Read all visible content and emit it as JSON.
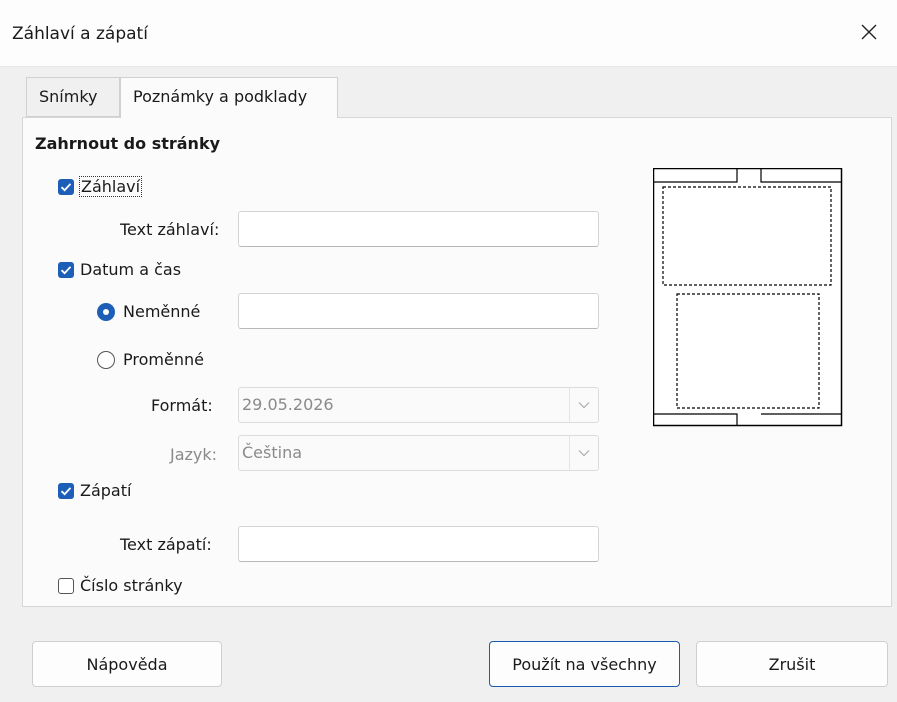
{
  "window": {
    "title": "Záhlaví a zápatí"
  },
  "tabs": [
    {
      "label": "Snímky"
    },
    {
      "label": "Poznámky a podklady"
    }
  ],
  "section": {
    "title": "Zahrnout do stránky"
  },
  "header": {
    "label": "Záhlaví",
    "checked": true,
    "text_label": "Text záhlaví:",
    "text_value": ""
  },
  "datetime": {
    "label": "Datum a čas",
    "checked": true,
    "fixed_label": "Neměnné",
    "fixed_value": "",
    "variable_label": "Proměnné",
    "format_label": "Formát:",
    "format_value": "29.05.2026",
    "language_label": "Jazyk:",
    "language_value": "Čeština"
  },
  "footer": {
    "label": "Zápatí",
    "checked": true,
    "text_label": "Text zápatí:",
    "text_value": ""
  },
  "page_number": {
    "label": "Číslo stránky",
    "checked": false
  },
  "buttons": {
    "help": "Nápověda",
    "apply_all": "Použít na všechny",
    "cancel": "Zrušit"
  },
  "colors": {
    "accent": "#1d5fb6",
    "panel": "#fbfbfb",
    "dialog": "#f0f0f0"
  },
  "icons": {
    "close": "close-icon",
    "check": "checkmark-icon",
    "chevron": "chevron-down-icon"
  }
}
